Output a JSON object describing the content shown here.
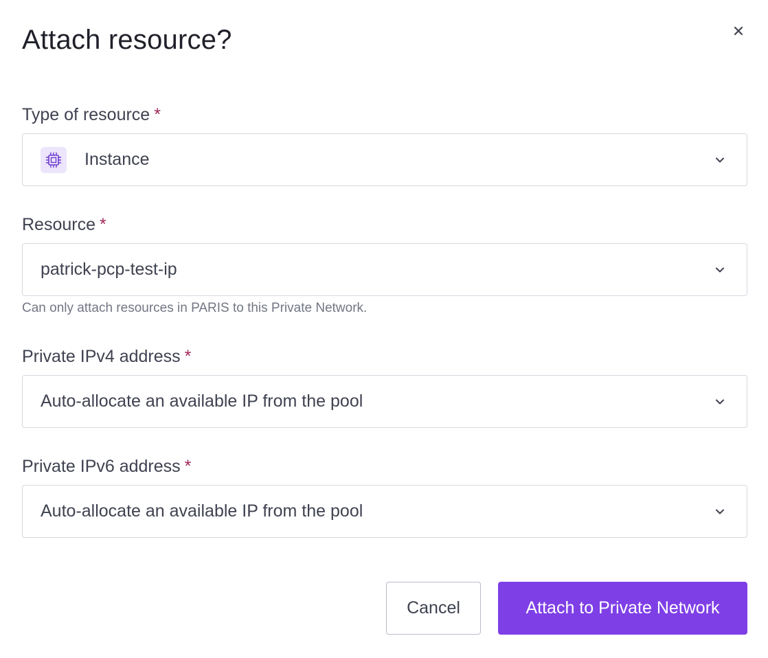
{
  "dialog": {
    "title": "Attach resource?",
    "close_icon": "close-icon"
  },
  "fields": {
    "type": {
      "label": "Type of resource",
      "required_mark": "*",
      "value": "Instance",
      "icon": "chip-icon"
    },
    "resource": {
      "label": "Resource",
      "required_mark": "*",
      "value": "patrick-pcp-test-ip",
      "helper": "Can only attach resources in PARIS to this Private Network."
    },
    "ipv4": {
      "label": "Private IPv4 address",
      "required_mark": "*",
      "value": "Auto-allocate an available IP from the pool"
    },
    "ipv6": {
      "label": "Private IPv6 address",
      "required_mark": "*",
      "value": "Auto-allocate an available IP from the pool"
    }
  },
  "actions": {
    "cancel_label": "Cancel",
    "submit_label": "Attach to Private Network"
  },
  "colors": {
    "primary": "#7e3fe6",
    "required": "#a1295b",
    "icon_bg": "#ece5fb"
  }
}
